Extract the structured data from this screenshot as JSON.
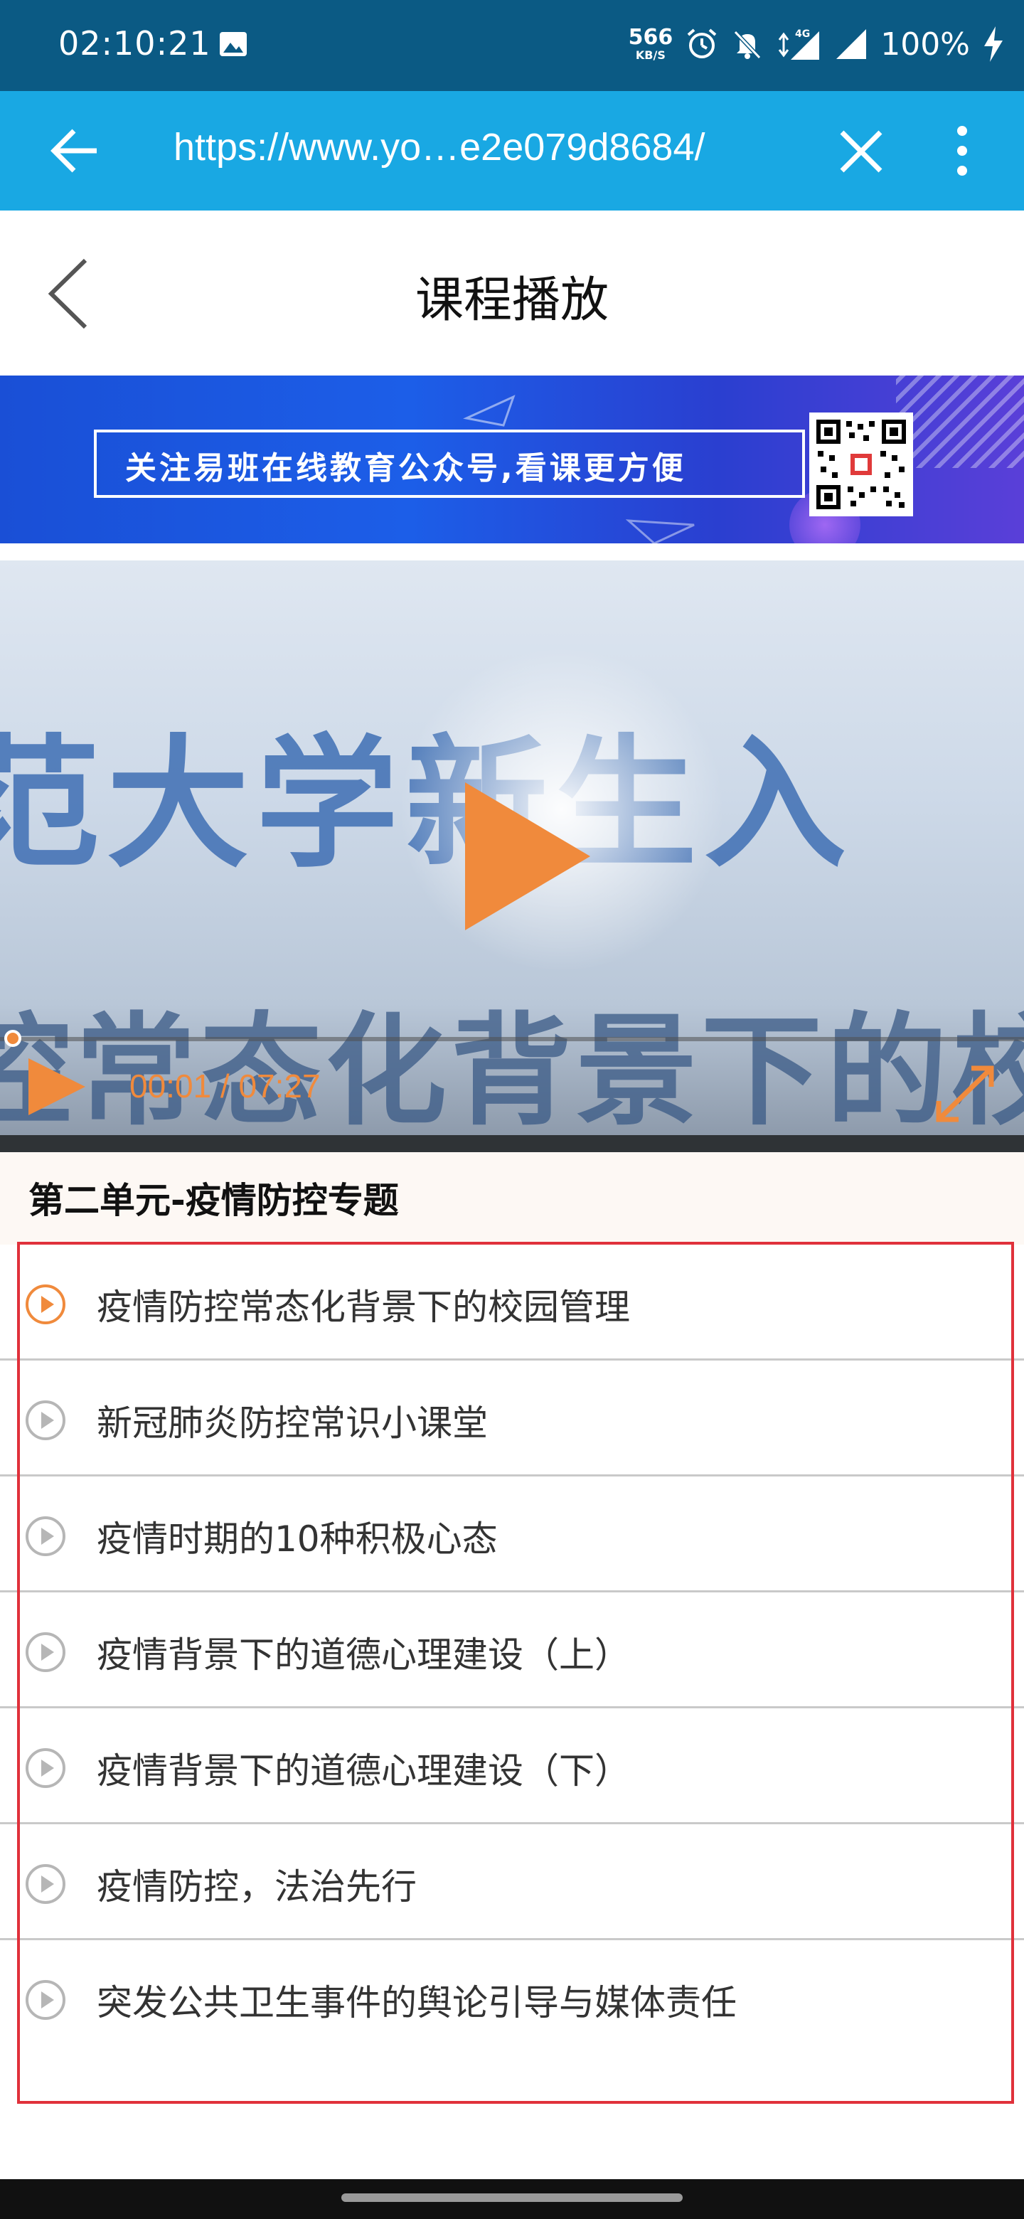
{
  "status_bar": {
    "time": "02:10:21",
    "net_speed_value": "566",
    "net_speed_unit": "KB/S",
    "network_label": "4G",
    "battery_percent": "100%"
  },
  "browser": {
    "url": "https://www.yo…e2e079d8684/"
  },
  "header": {
    "title": "课程播放"
  },
  "banner": {
    "text": "关注易班在线教育公众号,看课更方便"
  },
  "video": {
    "overlay_line1": "范大学新生入",
    "overlay_line2": "控常态化背景下的校",
    "current_time": "00:01",
    "separator": " / ",
    "duration": "07:27",
    "progress": 0.0022,
    "accent_color": "#f08a3c"
  },
  "unit": {
    "title": "第二单元-疫情防控专题"
  },
  "lessons": [
    {
      "label": "疫情防控常态化背景下的校园管理",
      "active": true
    },
    {
      "label": "新冠肺炎防控常识小课堂",
      "active": false
    },
    {
      "label": "疫情时期的10种积极心态",
      "active": false
    },
    {
      "label": "疫情背景下的道德心理建设（上）",
      "active": false
    },
    {
      "label": "疫情背景下的道德心理建设（下）",
      "active": false
    },
    {
      "label": "疫情防控，法治先行",
      "active": false
    },
    {
      "label": "突发公共卫生事件的舆论引导与媒体责任",
      "active": false
    }
  ]
}
